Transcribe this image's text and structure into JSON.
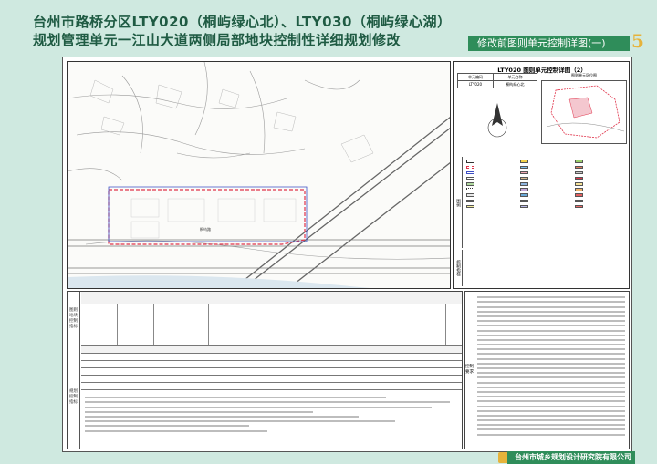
{
  "header": {
    "title_line1": "台州市路桥分区LTY020（桐屿绿心北）、LTY030（桐屿绿心湖）",
    "title_line2": "规划管理单元一江山大道两侧局部地块控制性详细规划修改",
    "section_label": "修改前图则单元控制详图(一)",
    "page_number": "5"
  },
  "legend_panel": {
    "title": "LTY020 图则单元控制详图（2）",
    "unit_table": [
      [
        "单元编码",
        "单元名称"
      ],
      [
        "LTY020",
        "桐屿绿心北"
      ]
    ],
    "location_label": "图则单元区位图",
    "side_label_legend": "图例",
    "side_label_indicator": "控制指标"
  },
  "table_area": {
    "side_label_top": "图则地块控制指标",
    "side_label_bottom": "规划控制指标"
  },
  "text_area": {
    "side_label": "控制要求"
  },
  "footer": {
    "org_name": "台州市城乡规划设计研究院有限公司"
  },
  "colors": {
    "accent_green": "#2f8d5a",
    "title_green": "#1f5b43",
    "page_number_gold": "#e6b33b",
    "boundary_red": "#e0334a",
    "boundary_blue": "#3d4fc4",
    "background": "#cfe9e0"
  }
}
